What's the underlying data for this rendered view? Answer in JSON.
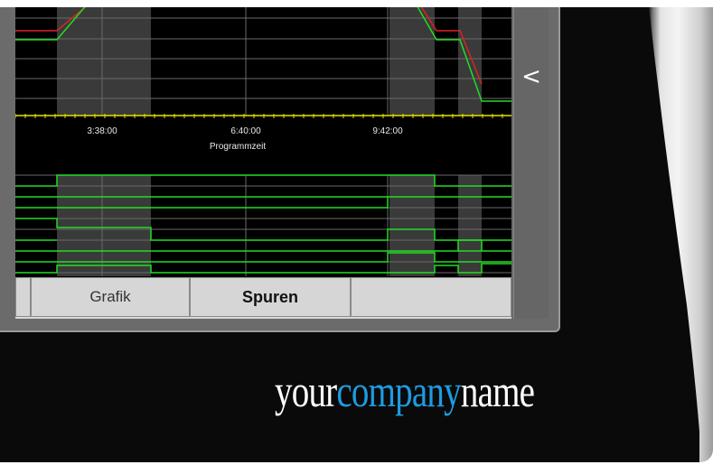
{
  "screen": {
    "time_ticks": [
      "3:38:00",
      "6:40:00",
      "9:42:00"
    ],
    "x_axis_label": "Programmzeit",
    "collapse_glyph": "<"
  },
  "tabs": [
    {
      "label": ""
    },
    {
      "label": "Grafik"
    },
    {
      "label": "Spuren"
    },
    {
      "label": ""
    }
  ],
  "logo": {
    "part1": "your",
    "part2": "company",
    "part3": "name"
  },
  "colors": {
    "accent_blue": "#1e9be0",
    "trace_green": "#22dd22",
    "trace_red": "#dd2222",
    "axis_yellow": "#e8e000"
  }
}
